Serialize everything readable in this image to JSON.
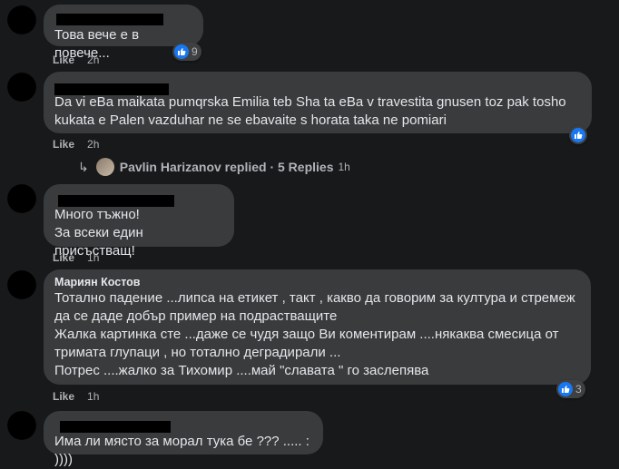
{
  "comments": [
    {
      "text": "Това вече е в повече...",
      "like_label": "Like",
      "time": "2h",
      "reactions": "9"
    },
    {
      "text": "Da vi eBa maikata pumqrska Emilia teb Sha ta eBa v travestita gnusen toz pak tosho\nkukata e Palen vazduhar ne se ebavaite s horata taka ne pomiari",
      "like_label": "Like",
      "time": "2h",
      "replies": {
        "text": "Pavlin Harizanov replied · 5 Replies",
        "time": "1h"
      }
    },
    {
      "text": "Много тъжно!\nЗа всеки един присъстващ!",
      "like_label": "Like",
      "time": "1h"
    },
    {
      "author": "Мариян Костов",
      "text": "Тотално падение ...липса на етикет , такт , какво да говорим за култура и стремеж\nда се даде добър пример на подрастващите\nЖалка картинка сте ...даже се чудя защо Ви коментирам ....някаква смесица от\nтримата глупаци , но тотално деградирали ...\nПотрес ....жалко за Тихомир ....май \"славата \" го заслепява",
      "like_label": "Like",
      "time": "1h",
      "reactions": "3"
    },
    {
      "text": "Има ли място за морал тука бе ??? ..... : ))))"
    }
  ],
  "colors": {
    "background": "#18191a",
    "bubble": "#3a3b3c",
    "like_blue": "#1877f2"
  }
}
